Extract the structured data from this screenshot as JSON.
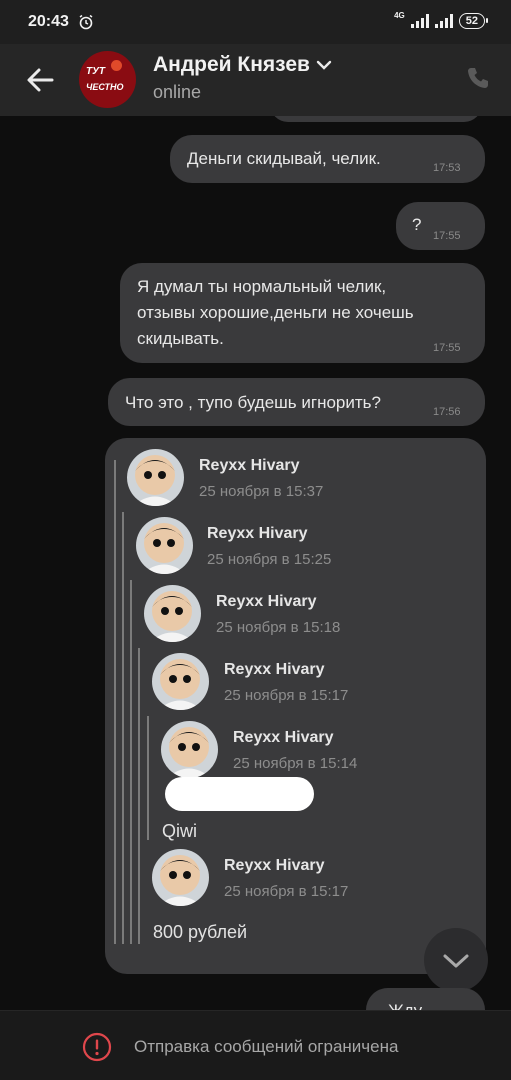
{
  "status_bar": {
    "time": "20:43",
    "network": "4G",
    "battery": "52"
  },
  "header": {
    "contact_name": "Андрей Князев",
    "status": "online",
    "avatar_text_line1": "ТУТ",
    "avatar_text_line2": "ЧЕСТНО"
  },
  "messages": [
    {
      "text": "Деньги скидывай, челик.",
      "time": "17:53"
    },
    {
      "text": "?",
      "time": "17:55"
    },
    {
      "lines": [
        "Я думал ты нормальный челик,",
        "отзывы хорошие,деньги не хочешь",
        "скидывать."
      ],
      "time": "17:55"
    },
    {
      "text": "Что это , тупо будешь игнорить?",
      "time": "17:56"
    }
  ],
  "forwarded": [
    {
      "name": "Reyxx Hivary",
      "date": "25 ноября в 15:37"
    },
    {
      "name": "Reyxx Hivary",
      "date": "25 ноября в 15:25"
    },
    {
      "name": "Reyxx Hivary",
      "date": "25 ноября в 15:18"
    },
    {
      "name": "Reyxx Hivary",
      "date": "25 ноября в 15:17"
    },
    {
      "name": "Reyxx Hivary",
      "date": "25 ноября в 15:14"
    },
    {
      "name": "Reyxx Hivary",
      "date": "25 ноября в 15:17"
    }
  ],
  "forwarded_texts": {
    "qiwi": "Qiwi",
    "amount": "800 рублей"
  },
  "partial_message": "Жду",
  "footer": {
    "notice": "Отправка сообщений ограничена"
  },
  "colors": {
    "bubble": "#3a3a3c",
    "background": "#0e0e0e",
    "header": "#262626",
    "warning": "#e0474c"
  }
}
